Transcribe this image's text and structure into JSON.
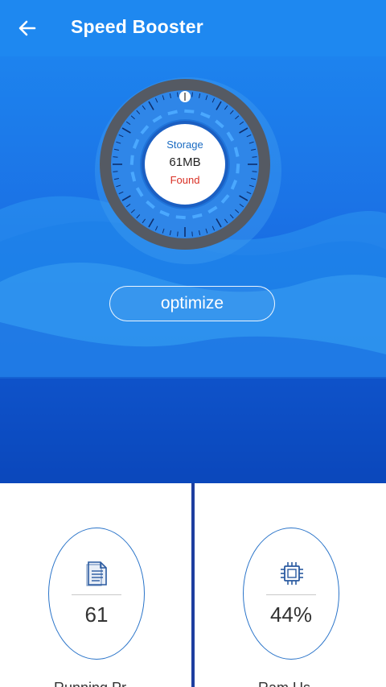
{
  "header": {
    "title": "Speed Booster",
    "back_icon": "arrow-left-icon",
    "background": "#1e88f0"
  },
  "gauge": {
    "label": "Storage",
    "value": "61MB",
    "status": "Found",
    "status_color": "#d93025"
  },
  "actions": {
    "optimize_label": "optimize"
  },
  "cards": [
    {
      "icon": "document-icon",
      "value": "61",
      "caption": "Running Pr..."
    },
    {
      "icon": "cpu-chip-icon",
      "value": "44%",
      "caption": "Ram Us..."
    }
  ]
}
